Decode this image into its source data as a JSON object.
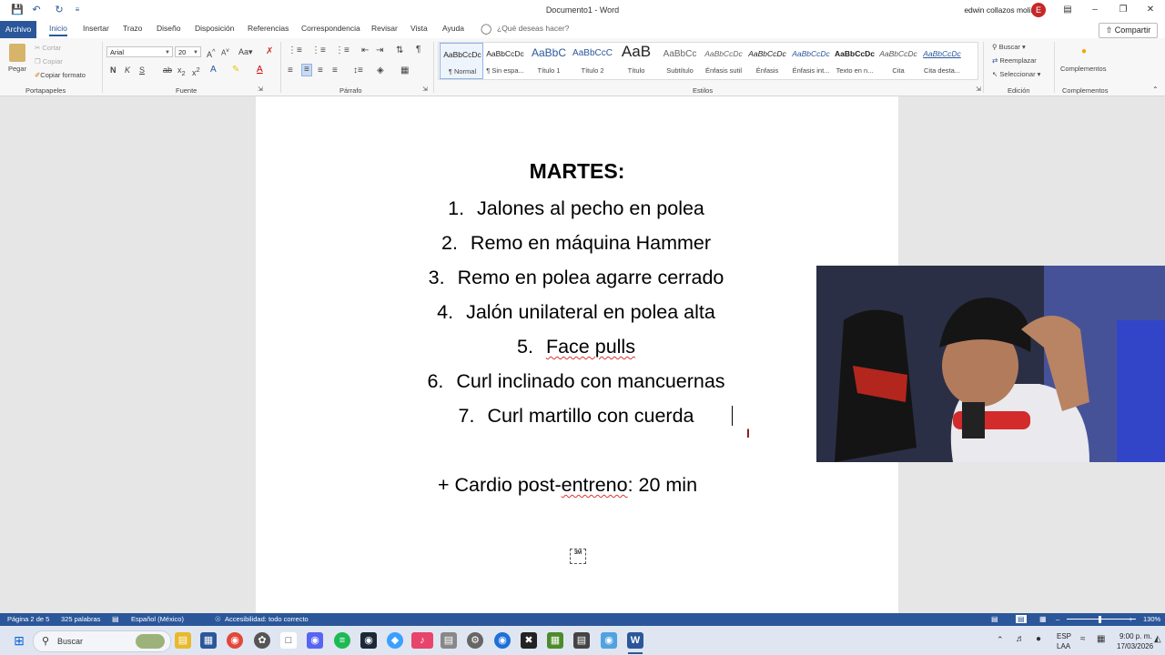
{
  "window": {
    "title": "Documento1 - Word",
    "user": "edwin collazos molina",
    "avatar_initial": "E"
  },
  "tabs": [
    "Archivo",
    "Inicio",
    "Insertar",
    "Trazo",
    "Diseño",
    "Disposición",
    "Referencias",
    "Correspondencia",
    "Revisar",
    "Vista",
    "Ayuda"
  ],
  "tell_me": "¿Qué deseas hacer?",
  "share_label": "Compartir",
  "ribbon": {
    "clipboard": {
      "paste": "Pegar",
      "cut": "Cortar",
      "copy": "Copiar",
      "format_painter": "Copiar formato",
      "label": "Portapapeles"
    },
    "font": {
      "name": "Arial",
      "size": "20",
      "label": "Fuente"
    },
    "paragraph_label": "Párrafo",
    "styles": [
      {
        "sample": "AaBbCcDc",
        "name": "¶ Normal"
      },
      {
        "sample": "AaBbCcDc",
        "name": "¶ Sin espa..."
      },
      {
        "sample": "AaBbC",
        "name": "Título 1"
      },
      {
        "sample": "AaBbCcC",
        "name": "Título 2"
      },
      {
        "sample": "AaB",
        "name": "Título"
      },
      {
        "sample": "AaBbCc",
        "name": "Subtítulo"
      },
      {
        "sample": "AaBbCcDc",
        "name": "Énfasis sutil"
      },
      {
        "sample": "AaBbCcDc",
        "name": "Énfasis"
      },
      {
        "sample": "AaBbCcDc",
        "name": "Énfasis int..."
      },
      {
        "sample": "AaBbCcDc",
        "name": "Texto en n..."
      },
      {
        "sample": "AaBbCcDc",
        "name": "Cita"
      },
      {
        "sample": "AaBbCcDc",
        "name": "Cita desta..."
      }
    ],
    "styles_label": "Estilos",
    "editing": {
      "find": "Buscar",
      "replace": "Reemplazar",
      "select": "Seleccionar",
      "label": "Edición"
    },
    "addins": {
      "button": "Complementos",
      "label": "Complementos"
    }
  },
  "document": {
    "heading": "MARTES:",
    "items": [
      {
        "num": "1.",
        "text": "Jalones al pecho en polea"
      },
      {
        "num": "2.",
        "text": "Remo en máquina Hammer"
      },
      {
        "num": "3.",
        "text": "Remo en polea agarre cerrado"
      },
      {
        "num": "4.",
        "text": "Jalón unilateral en polea alta"
      },
      {
        "num": "5.",
        "text": "Face pulls"
      },
      {
        "num": "6.",
        "text": "Curl inclinado con mancuernas"
      },
      {
        "num": "7.",
        "text": "Curl martillo con cuerda"
      }
    ],
    "cardio_prefix": "+ Cardio post-",
    "cardio_word": "entreno",
    "cardio_suffix": ": 20 min",
    "small_icon_text": "3M"
  },
  "status": {
    "page": "Página 2 de 5",
    "words": "325 palabras",
    "language": "Español (México)",
    "accessibility": "Accesibilidad: todo correcto",
    "zoom": "130%"
  },
  "taskbar": {
    "search": "Buscar",
    "lang": "ESP",
    "lang2": "LAA",
    "time": "9:00 p. m.",
    "date": "17/03/2026"
  }
}
